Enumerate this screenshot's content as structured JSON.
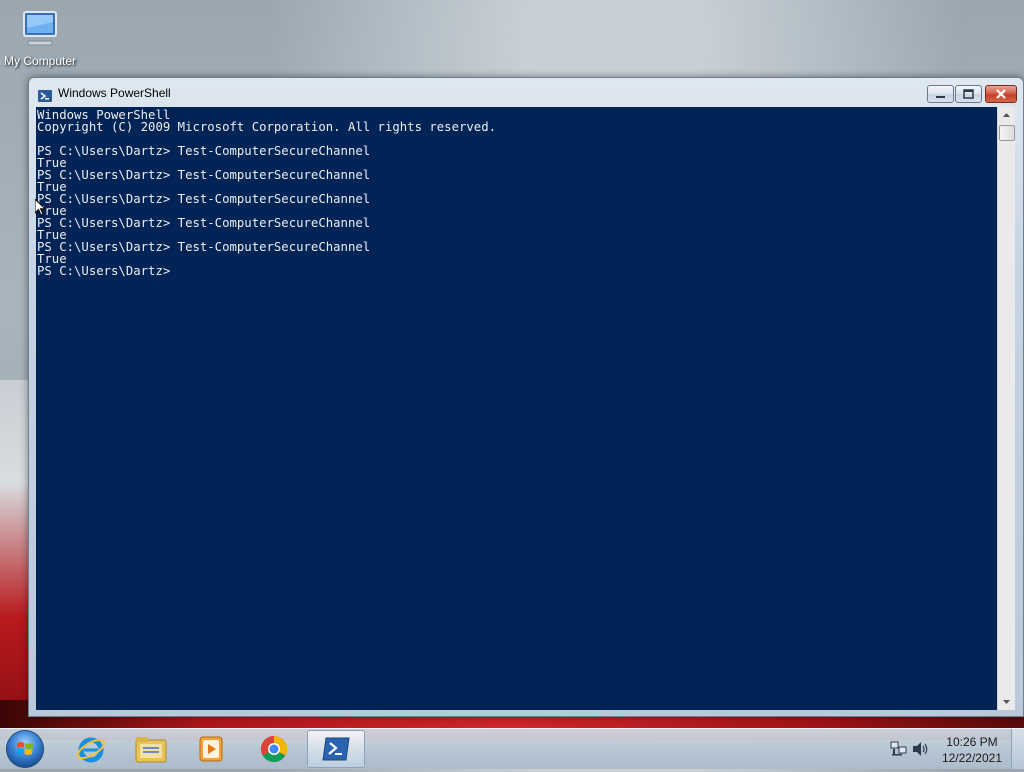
{
  "desktop": {
    "icons": [
      {
        "label": "My Computer",
        "icon": "computer-icon"
      }
    ]
  },
  "window": {
    "title": "Windows PowerShell",
    "icon": "powershell-icon",
    "controls": {
      "minimize": "minimize-icon",
      "maximize": "maximize-icon",
      "close": "close-icon"
    },
    "console": {
      "background": "#012456",
      "foreground": "#eeedf0",
      "lines": [
        "Windows PowerShell",
        "Copyright (C) 2009 Microsoft Corporation. All rights reserved.",
        "",
        "PS C:\\Users\\Dartz> Test-ComputerSecureChannel",
        "True",
        "PS C:\\Users\\Dartz> Test-ComputerSecureChannel",
        "True",
        "PS C:\\Users\\Dartz> Test-ComputerSecureChannel",
        "True",
        "PS C:\\Users\\Dartz> Test-ComputerSecureChannel",
        "True",
        "PS C:\\Users\\Dartz> Test-ComputerSecureChannel",
        "True",
        "PS C:\\Users\\Dartz>"
      ]
    }
  },
  "taskbar": {
    "start": "windows-start-icon",
    "pinned": [
      {
        "name": "internet-explorer-icon"
      },
      {
        "name": "file-explorer-icon"
      },
      {
        "name": "media-player-icon"
      },
      {
        "name": "chrome-icon"
      },
      {
        "name": "powershell-icon",
        "active": true
      }
    ],
    "tray": {
      "network": "network-icon",
      "volume": "volume-icon",
      "time": "10:26 PM",
      "date": "12/22/2021"
    }
  }
}
